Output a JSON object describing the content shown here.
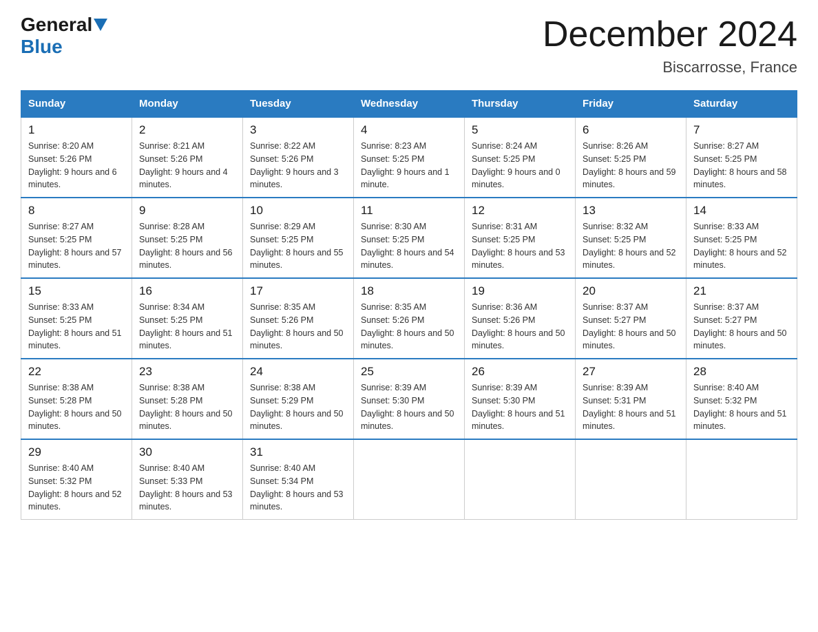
{
  "header": {
    "logo_general": "General",
    "logo_blue": "Blue",
    "title": "December 2024",
    "subtitle": "Biscarrosse, France"
  },
  "days_of_week": [
    "Sunday",
    "Monday",
    "Tuesday",
    "Wednesday",
    "Thursday",
    "Friday",
    "Saturday"
  ],
  "weeks": [
    [
      {
        "day": "1",
        "sunrise": "8:20 AM",
        "sunset": "5:26 PM",
        "daylight": "9 hours and 6 minutes."
      },
      {
        "day": "2",
        "sunrise": "8:21 AM",
        "sunset": "5:26 PM",
        "daylight": "9 hours and 4 minutes."
      },
      {
        "day": "3",
        "sunrise": "8:22 AM",
        "sunset": "5:26 PM",
        "daylight": "9 hours and 3 minutes."
      },
      {
        "day": "4",
        "sunrise": "8:23 AM",
        "sunset": "5:25 PM",
        "daylight": "9 hours and 1 minute."
      },
      {
        "day": "5",
        "sunrise": "8:24 AM",
        "sunset": "5:25 PM",
        "daylight": "9 hours and 0 minutes."
      },
      {
        "day": "6",
        "sunrise": "8:26 AM",
        "sunset": "5:25 PM",
        "daylight": "8 hours and 59 minutes."
      },
      {
        "day": "7",
        "sunrise": "8:27 AM",
        "sunset": "5:25 PM",
        "daylight": "8 hours and 58 minutes."
      }
    ],
    [
      {
        "day": "8",
        "sunrise": "8:27 AM",
        "sunset": "5:25 PM",
        "daylight": "8 hours and 57 minutes."
      },
      {
        "day": "9",
        "sunrise": "8:28 AM",
        "sunset": "5:25 PM",
        "daylight": "8 hours and 56 minutes."
      },
      {
        "day": "10",
        "sunrise": "8:29 AM",
        "sunset": "5:25 PM",
        "daylight": "8 hours and 55 minutes."
      },
      {
        "day": "11",
        "sunrise": "8:30 AM",
        "sunset": "5:25 PM",
        "daylight": "8 hours and 54 minutes."
      },
      {
        "day": "12",
        "sunrise": "8:31 AM",
        "sunset": "5:25 PM",
        "daylight": "8 hours and 53 minutes."
      },
      {
        "day": "13",
        "sunrise": "8:32 AM",
        "sunset": "5:25 PM",
        "daylight": "8 hours and 52 minutes."
      },
      {
        "day": "14",
        "sunrise": "8:33 AM",
        "sunset": "5:25 PM",
        "daylight": "8 hours and 52 minutes."
      }
    ],
    [
      {
        "day": "15",
        "sunrise": "8:33 AM",
        "sunset": "5:25 PM",
        "daylight": "8 hours and 51 minutes."
      },
      {
        "day": "16",
        "sunrise": "8:34 AM",
        "sunset": "5:25 PM",
        "daylight": "8 hours and 51 minutes."
      },
      {
        "day": "17",
        "sunrise": "8:35 AM",
        "sunset": "5:26 PM",
        "daylight": "8 hours and 50 minutes."
      },
      {
        "day": "18",
        "sunrise": "8:35 AM",
        "sunset": "5:26 PM",
        "daylight": "8 hours and 50 minutes."
      },
      {
        "day": "19",
        "sunrise": "8:36 AM",
        "sunset": "5:26 PM",
        "daylight": "8 hours and 50 minutes."
      },
      {
        "day": "20",
        "sunrise": "8:37 AM",
        "sunset": "5:27 PM",
        "daylight": "8 hours and 50 minutes."
      },
      {
        "day": "21",
        "sunrise": "8:37 AM",
        "sunset": "5:27 PM",
        "daylight": "8 hours and 50 minutes."
      }
    ],
    [
      {
        "day": "22",
        "sunrise": "8:38 AM",
        "sunset": "5:28 PM",
        "daylight": "8 hours and 50 minutes."
      },
      {
        "day": "23",
        "sunrise": "8:38 AM",
        "sunset": "5:28 PM",
        "daylight": "8 hours and 50 minutes."
      },
      {
        "day": "24",
        "sunrise": "8:38 AM",
        "sunset": "5:29 PM",
        "daylight": "8 hours and 50 minutes."
      },
      {
        "day": "25",
        "sunrise": "8:39 AM",
        "sunset": "5:30 PM",
        "daylight": "8 hours and 50 minutes."
      },
      {
        "day": "26",
        "sunrise": "8:39 AM",
        "sunset": "5:30 PM",
        "daylight": "8 hours and 51 minutes."
      },
      {
        "day": "27",
        "sunrise": "8:39 AM",
        "sunset": "5:31 PM",
        "daylight": "8 hours and 51 minutes."
      },
      {
        "day": "28",
        "sunrise": "8:40 AM",
        "sunset": "5:32 PM",
        "daylight": "8 hours and 51 minutes."
      }
    ],
    [
      {
        "day": "29",
        "sunrise": "8:40 AM",
        "sunset": "5:32 PM",
        "daylight": "8 hours and 52 minutes."
      },
      {
        "day": "30",
        "sunrise": "8:40 AM",
        "sunset": "5:33 PM",
        "daylight": "8 hours and 53 minutes."
      },
      {
        "day": "31",
        "sunrise": "8:40 AM",
        "sunset": "5:34 PM",
        "daylight": "8 hours and 53 minutes."
      },
      null,
      null,
      null,
      null
    ]
  ]
}
